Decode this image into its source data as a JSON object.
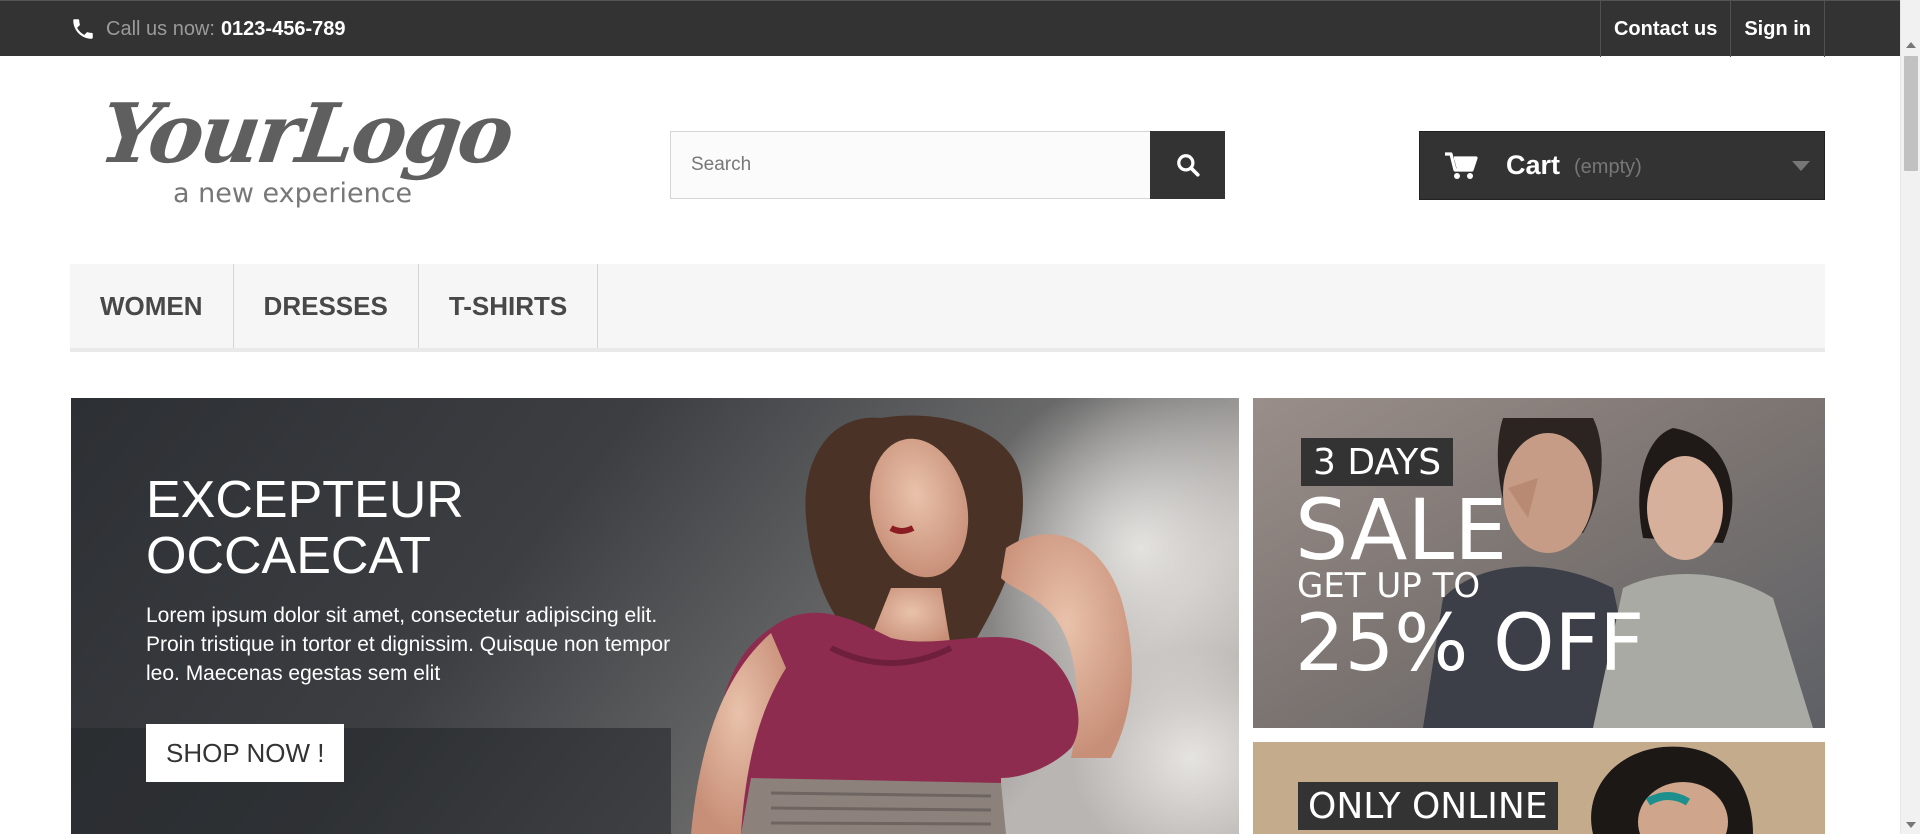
{
  "topbar": {
    "call_label": "Call us now:",
    "phone": "0123-456-789",
    "contact_label": "Contact us",
    "signin_label": "Sign in",
    "icon": "phone-icon"
  },
  "header": {
    "logo_text": "YourLogo",
    "logo_tagline": "a new experience",
    "search": {
      "placeholder": "Search",
      "value": "",
      "button_icon": "search-icon"
    },
    "cart": {
      "label": "Cart",
      "state": "(empty)",
      "icon": "cart-icon"
    }
  },
  "menu": {
    "items": [
      {
        "label": "WOMEN"
      },
      {
        "label": "DRESSES"
      },
      {
        "label": "T-SHIRTS"
      }
    ]
  },
  "slider": {
    "title_line1": "EXCEPTEUR",
    "title_line2": "OCCAECAT",
    "description": "Lorem ipsum dolor sit amet, consectetur adipiscing elit. Proin tristique in tortor et dignissim. Quisque non tempor leo. Maecenas egestas sem elit",
    "button_label": "SHOP NOW !"
  },
  "promos": [
    {
      "tag": "3 DAYS",
      "headline": "SALE",
      "subline": "GET UP TO",
      "offer": "25% OFF"
    },
    {
      "tag": "ONLY ONLINE"
    }
  ],
  "colors": {
    "dark": "#333333",
    "menu_bg": "#f6f6f6",
    "accent_dress": "#8e2c4f"
  }
}
